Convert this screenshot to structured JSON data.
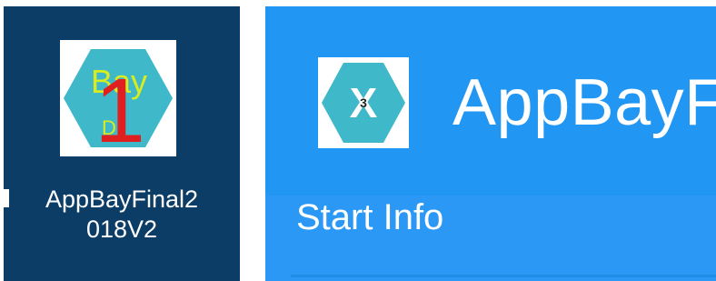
{
  "launcher": {
    "app_name_line1": "AppBayFinal2",
    "app_name_line2": "018V2",
    "icon": {
      "name": "appbay-hexagon-icon",
      "text_top": "Bay",
      "text_bottom": "D",
      "badge_number": "1",
      "hex_color": "#3fb8c9",
      "text_color": "#d9ec1f",
      "badge_color": "#e02020"
    },
    "background_color": "#0c3d66"
  },
  "app_bar": {
    "icon": {
      "name": "xamarin-icon",
      "letter": "X",
      "small_mark": "3",
      "hex_color": "#3fb8c9"
    },
    "title": "AppBayF",
    "background_color": "#2196f3"
  },
  "tabs": {
    "active_label": "Start Info"
  }
}
